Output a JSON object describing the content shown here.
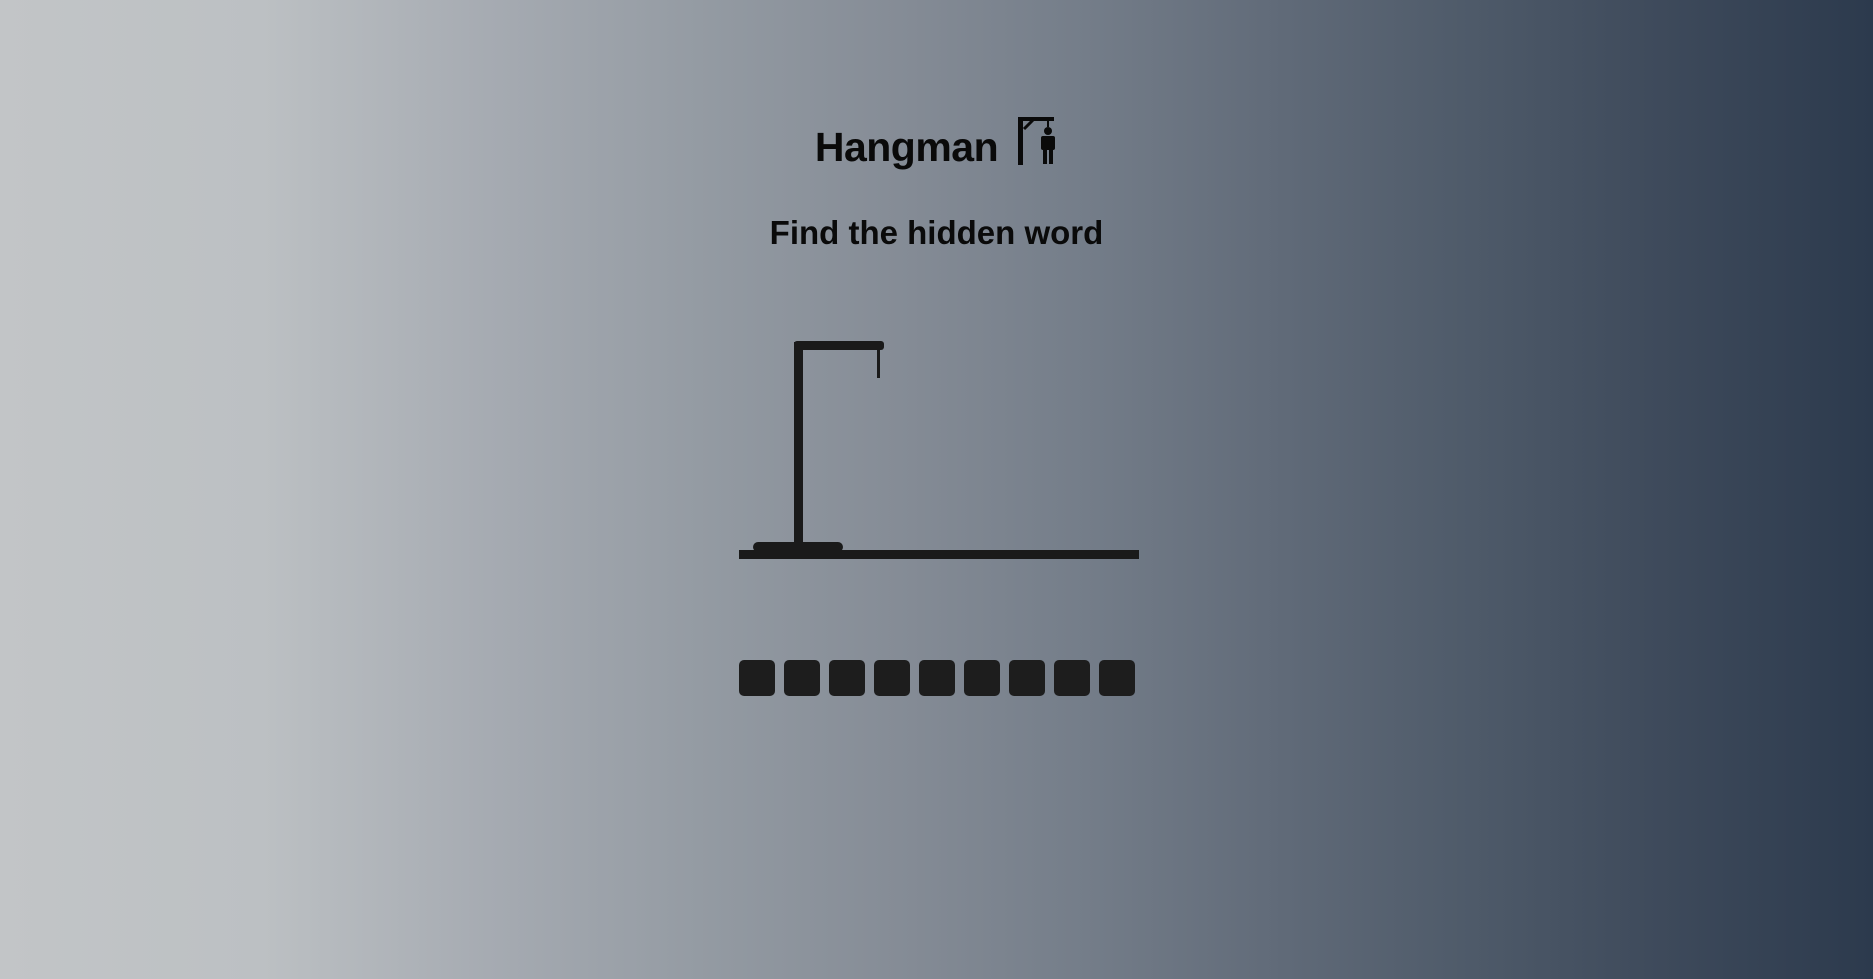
{
  "header": {
    "title": "Hangman",
    "title_icon": "gallows-man-icon"
  },
  "subtitle": "Find the hidden word",
  "game": {
    "wrong_guesses": 0,
    "gallows_color": "#1a1a1a",
    "word_length": 9,
    "slots": [
      "",
      "",
      "",
      "",
      "",
      "",
      "",
      "",
      ""
    ]
  }
}
